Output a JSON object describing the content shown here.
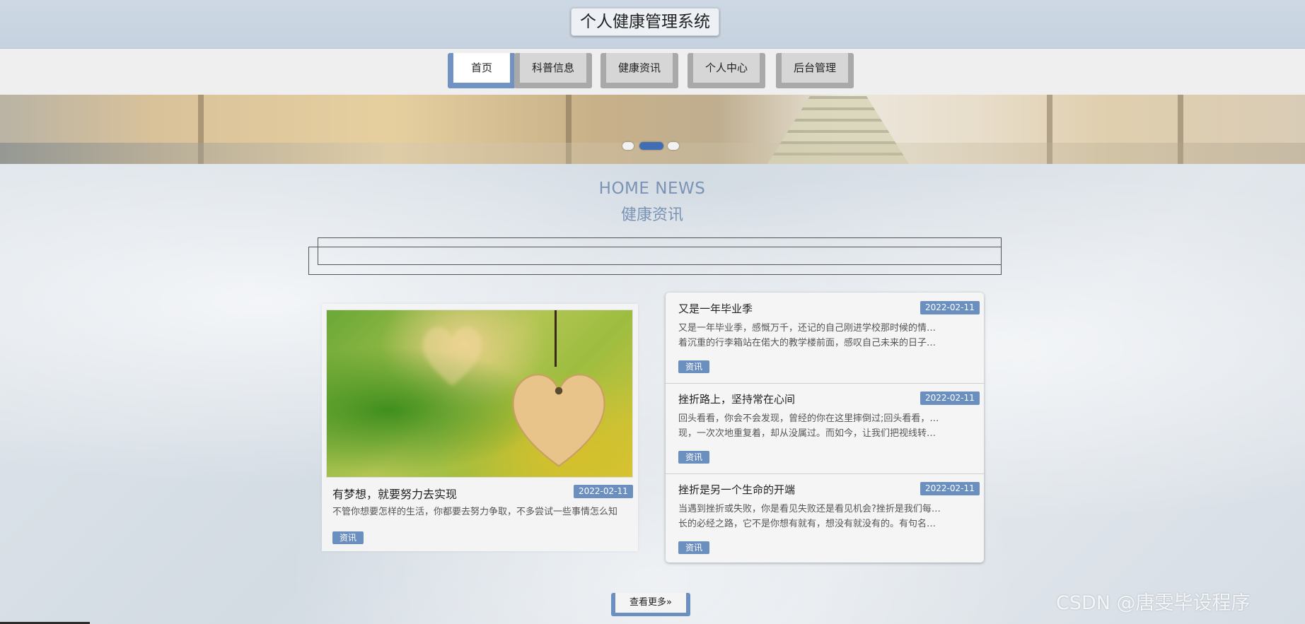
{
  "header": {
    "title": "个人健康管理系统"
  },
  "nav": {
    "items": [
      {
        "label": "首页",
        "active": true
      },
      {
        "label": "科普信息",
        "active": false
      },
      {
        "label": "健康资讯",
        "active": false
      },
      {
        "label": "个人中心",
        "active": false
      },
      {
        "label": "后台管理",
        "active": false
      }
    ]
  },
  "banner": {
    "slide_count": 3,
    "active_slide": 2
  },
  "section": {
    "title_en": "HOME NEWS",
    "title_cn": "健康资讯"
  },
  "featured": {
    "title": "有梦想，就要努力去实现",
    "date": "2022-02-11",
    "excerpt": "不管你想要怎样的生活，你都要去努力争取，不多尝试一些事情怎么知",
    "tag": "资讯"
  },
  "news": [
    {
      "title": "又是一年毕业季",
      "date": "2022-02-11",
      "excerpt_line1": "又是一年毕业季，感慨万千，还记的自己刚进学校那时候的情景，我拖",
      "excerpt_line2": "着沉重的行李箱站在偌大的教学楼前面，感叹自己未来的日子即将在…",
      "tag": "资讯"
    },
    {
      "title": "挫折路上，坚持常在心间",
      "date": "2022-02-11",
      "excerpt_line1": "回头看看，你会不会发现，曾经的你在这里摔倒过;回头看看，你是否发",
      "excerpt_line2": "现，一次次地重复着，却从没属过。而如今，让我们把视线转向前…",
      "tag": "资讯"
    },
    {
      "title": "挫折是另一个生命的开端",
      "date": "2022-02-11",
      "excerpt_line1": "当遇到挫折或失败，你是看见失败还是看见机会?挫折是我们每个人成",
      "excerpt_line2": "长的必经之路，它不是你想有就有，想没有就没有的。有句名言说的…",
      "tag": "资讯"
    }
  ],
  "more_button": {
    "label": "查看更多»"
  },
  "watermark": "CSDN @唐雯毕设程序",
  "colors": {
    "accent": "#6b8fbf",
    "nav_inactive_border": "#a9a9a9",
    "heading": "#7b93b4"
  }
}
